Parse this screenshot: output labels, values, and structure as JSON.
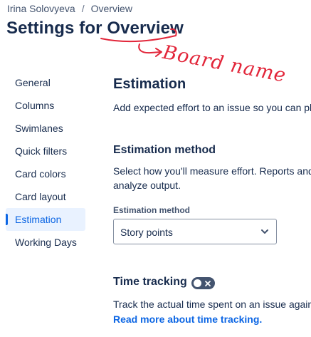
{
  "breadcrumb": {
    "items": [
      "Irina Solovyeva",
      "Overview"
    ],
    "separator": "/"
  },
  "header": {
    "title_prefix": "Settings for ",
    "title_board": "Overview",
    "annotation_text": "Board name",
    "annotation_color": "#e2263a"
  },
  "sidebar": {
    "items": [
      {
        "label": "General"
      },
      {
        "label": "Columns"
      },
      {
        "label": "Swimlanes"
      },
      {
        "label": "Quick filters"
      },
      {
        "label": "Card colors"
      },
      {
        "label": "Card layout"
      },
      {
        "label": "Estimation",
        "active": true
      },
      {
        "label": "Working Days"
      }
    ]
  },
  "main": {
    "heading": "Estimation",
    "description": "Add expected effort to an issue so you can pl",
    "method": {
      "heading": "Estimation method",
      "description_line1": "Select how you'll measure effort. Reports and",
      "description_line2": "analyze output.",
      "field_label": "Estimation method",
      "selected_value": "Story points"
    },
    "time_tracking": {
      "heading": "Time tracking",
      "enabled": false,
      "description": "Track the actual time spent on an issue agains",
      "link": "Read more about time tracking."
    }
  },
  "colors": {
    "accent": "#0c66e4",
    "active_bg": "#e9f2ff",
    "text": "#172b4d",
    "toggle_off": "#44546f"
  },
  "icons": {
    "select": "chevron-down-icon",
    "toggle": "close-icon"
  }
}
